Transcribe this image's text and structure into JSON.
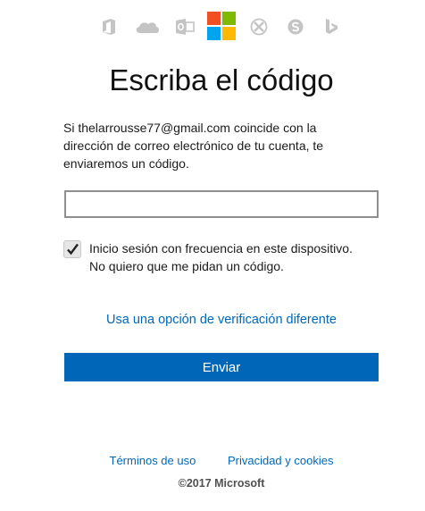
{
  "header": {
    "service_icons": [
      "office-icon",
      "onedrive-icon",
      "outlook-icon",
      "microsoft-logo",
      "xbox-icon",
      "skype-icon",
      "bing-icon"
    ],
    "logo_colors": [
      "#f25022",
      "#7fba00",
      "#00a4ef",
      "#ffb900"
    ],
    "icon_color": "#b8b8b8"
  },
  "main": {
    "title": "Escriba el código",
    "description": "Si thelarrousse77@gmail.com coincide con la dirección de correo electrónico de tu cuenta, te enviaremos un código.",
    "code_input": {
      "value": "",
      "placeholder": ""
    },
    "remember_checkbox": {
      "checked": true,
      "line1": "Inicio sesión con frecuencia en este dispositivo.",
      "line2": "No quiero que me pidan un código."
    },
    "alt_verification_link": "Usa una opción de verificación diferente",
    "send_button": "Enviar",
    "accent_color": "#0067b8"
  },
  "footer": {
    "terms_link": "Términos de uso",
    "privacy_link": "Privacidad y cookies",
    "copyright": "©2017 Microsoft"
  }
}
